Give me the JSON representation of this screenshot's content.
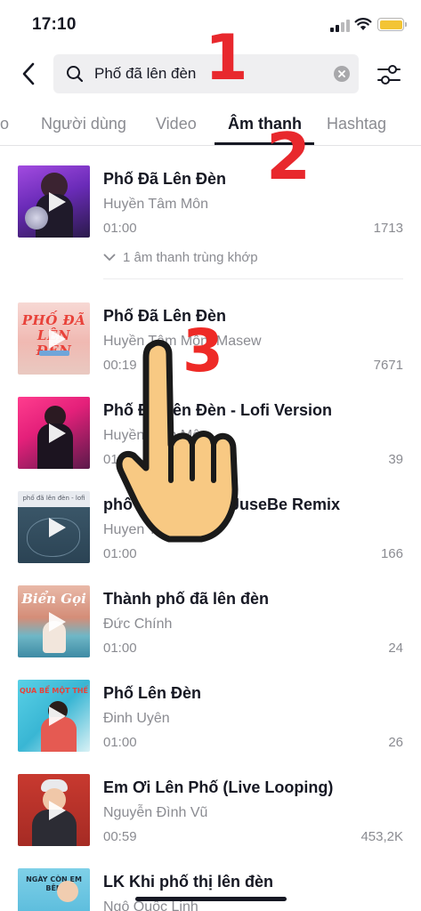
{
  "status_bar": {
    "time": "17:10",
    "battery_color": "#f3c434"
  },
  "header": {
    "back_icon": "chevron-left-icon",
    "search_query": "Phố đã lên đèn",
    "search_icon": "search-icon",
    "clear_icon": "clear-circle-icon",
    "filter_icon": "filter-sliders-icon"
  },
  "tabs": [
    {
      "label": "o",
      "active": false
    },
    {
      "label": "Người dùng",
      "active": false
    },
    {
      "label": "Video",
      "active": false
    },
    {
      "label": "Âm thanh",
      "active": true
    },
    {
      "label": "Hashtag",
      "active": false
    }
  ],
  "annotations": [
    "1",
    "2",
    "3"
  ],
  "results": [
    {
      "title": "Phố Đã Lên Đèn",
      "artist": "Huyền Tâm Môn",
      "duration": "01:00",
      "count": "1713",
      "match_text": "1 âm thanh trùng khớp"
    },
    {
      "title": "Phố Đã Lên Đèn",
      "artist": "Huyền Tâm Môn, Masew",
      "duration": "00:19",
      "count": "7671",
      "thumb_caption": "PHỐ ĐÃ LÊN ĐÈN"
    },
    {
      "title": "Phố Đã Lên Đèn - Lofi Version",
      "artist": "Huyền Tâm Môn",
      "duration": "01:00",
      "count": "39"
    },
    {
      "title": "phố đã lên đèn - JuseBe Remix",
      "artist": "Huyen Tam Mon",
      "duration": "01:00",
      "count": "166",
      "thumb_caption": "phố đã lên đèn - lofi"
    },
    {
      "title": "Thành phố đã lên đèn",
      "artist": "Đức Chính",
      "duration": "01:00",
      "count": "24",
      "thumb_caption": "Biển Gọi"
    },
    {
      "title": "Phố Lên Đèn",
      "artist": "Đinh Uyên",
      "duration": "01:00",
      "count": "26",
      "thumb_caption": "QUA BỂ MỘT THẾ"
    },
    {
      "title": "Em Ơi Lên Phố (Live Looping)",
      "artist": "Nguyễn Đình Vũ",
      "duration": "00:59",
      "count": "453,2K"
    },
    {
      "title": "LK Khi phố thị lên đèn",
      "artist": "Ngô Quốc Linh",
      "duration": "",
      "count": "",
      "thumb_caption": "NGÀY CÒN EM BÊN"
    }
  ],
  "accent_color": "#161823",
  "annotation_color": "#e8282d"
}
